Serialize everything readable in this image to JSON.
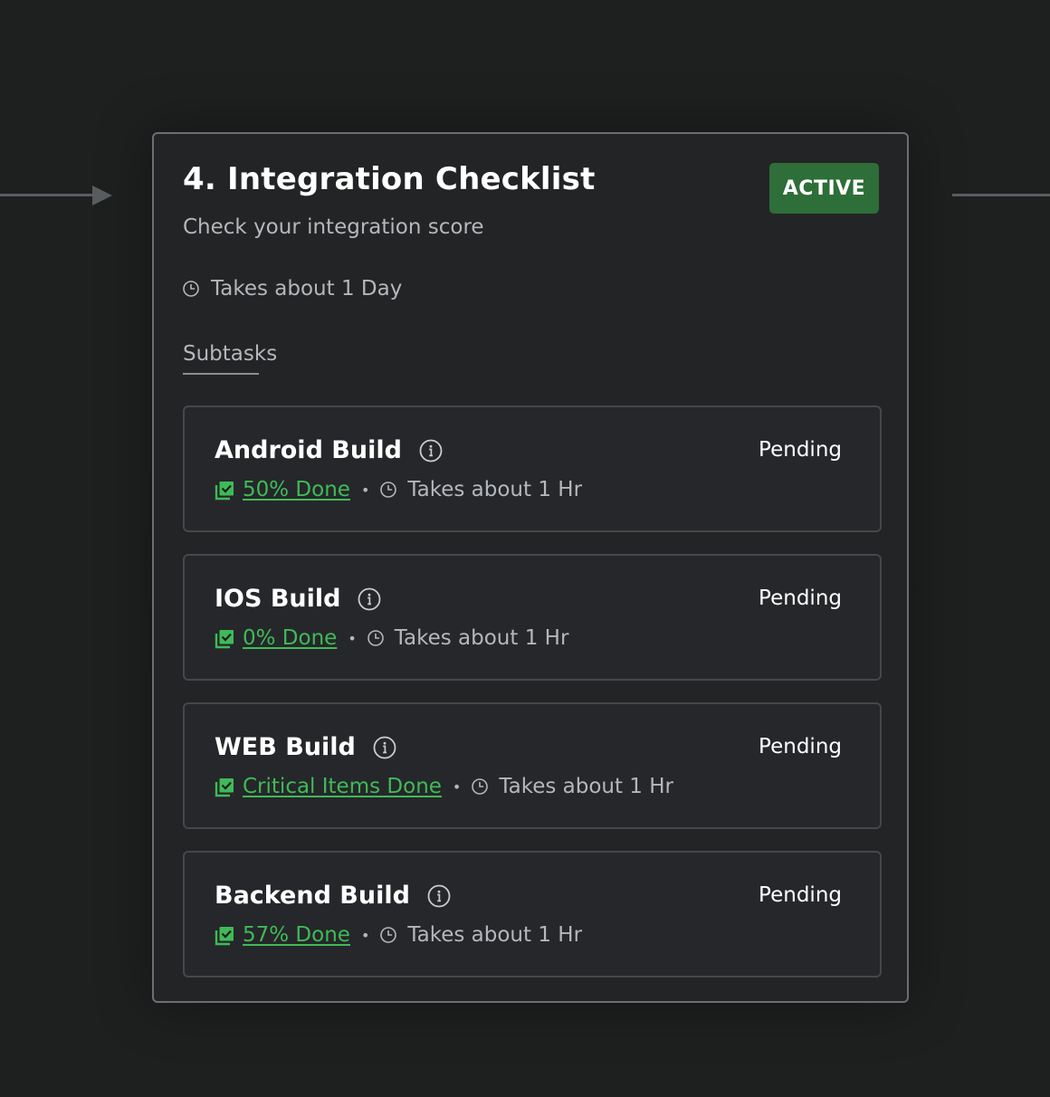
{
  "card": {
    "title": "4. Integration Checklist",
    "badge": "ACTIVE",
    "subtitle": "Check your integration score",
    "duration": "Takes about 1 Day",
    "tab": "Subtasks"
  },
  "subtasks": [
    {
      "name": "Android Build",
      "status": "Pending",
      "progress": "50% Done",
      "time": "Takes about 1 Hr"
    },
    {
      "name": "IOS Build",
      "status": "Pending",
      "progress": "0% Done",
      "time": "Takes about 1 Hr"
    },
    {
      "name": "WEB Build",
      "status": "Pending",
      "progress": "Critical Items Done",
      "time": "Takes about 1 Hr"
    },
    {
      "name": "Backend Build",
      "status": "Pending",
      "progress": "57% Done",
      "time": "Takes about 1 Hr"
    }
  ],
  "icons": {
    "clock": "clock-icon",
    "info": "info-icon",
    "progress": "checklist-check-icon",
    "connector": "arrow-right-icon"
  },
  "colors": {
    "background": "#1e1f1f",
    "card": "#232426",
    "badge": "#2e6e38",
    "progress_link": "#3fba58",
    "muted_text": "#b4b7bb"
  }
}
